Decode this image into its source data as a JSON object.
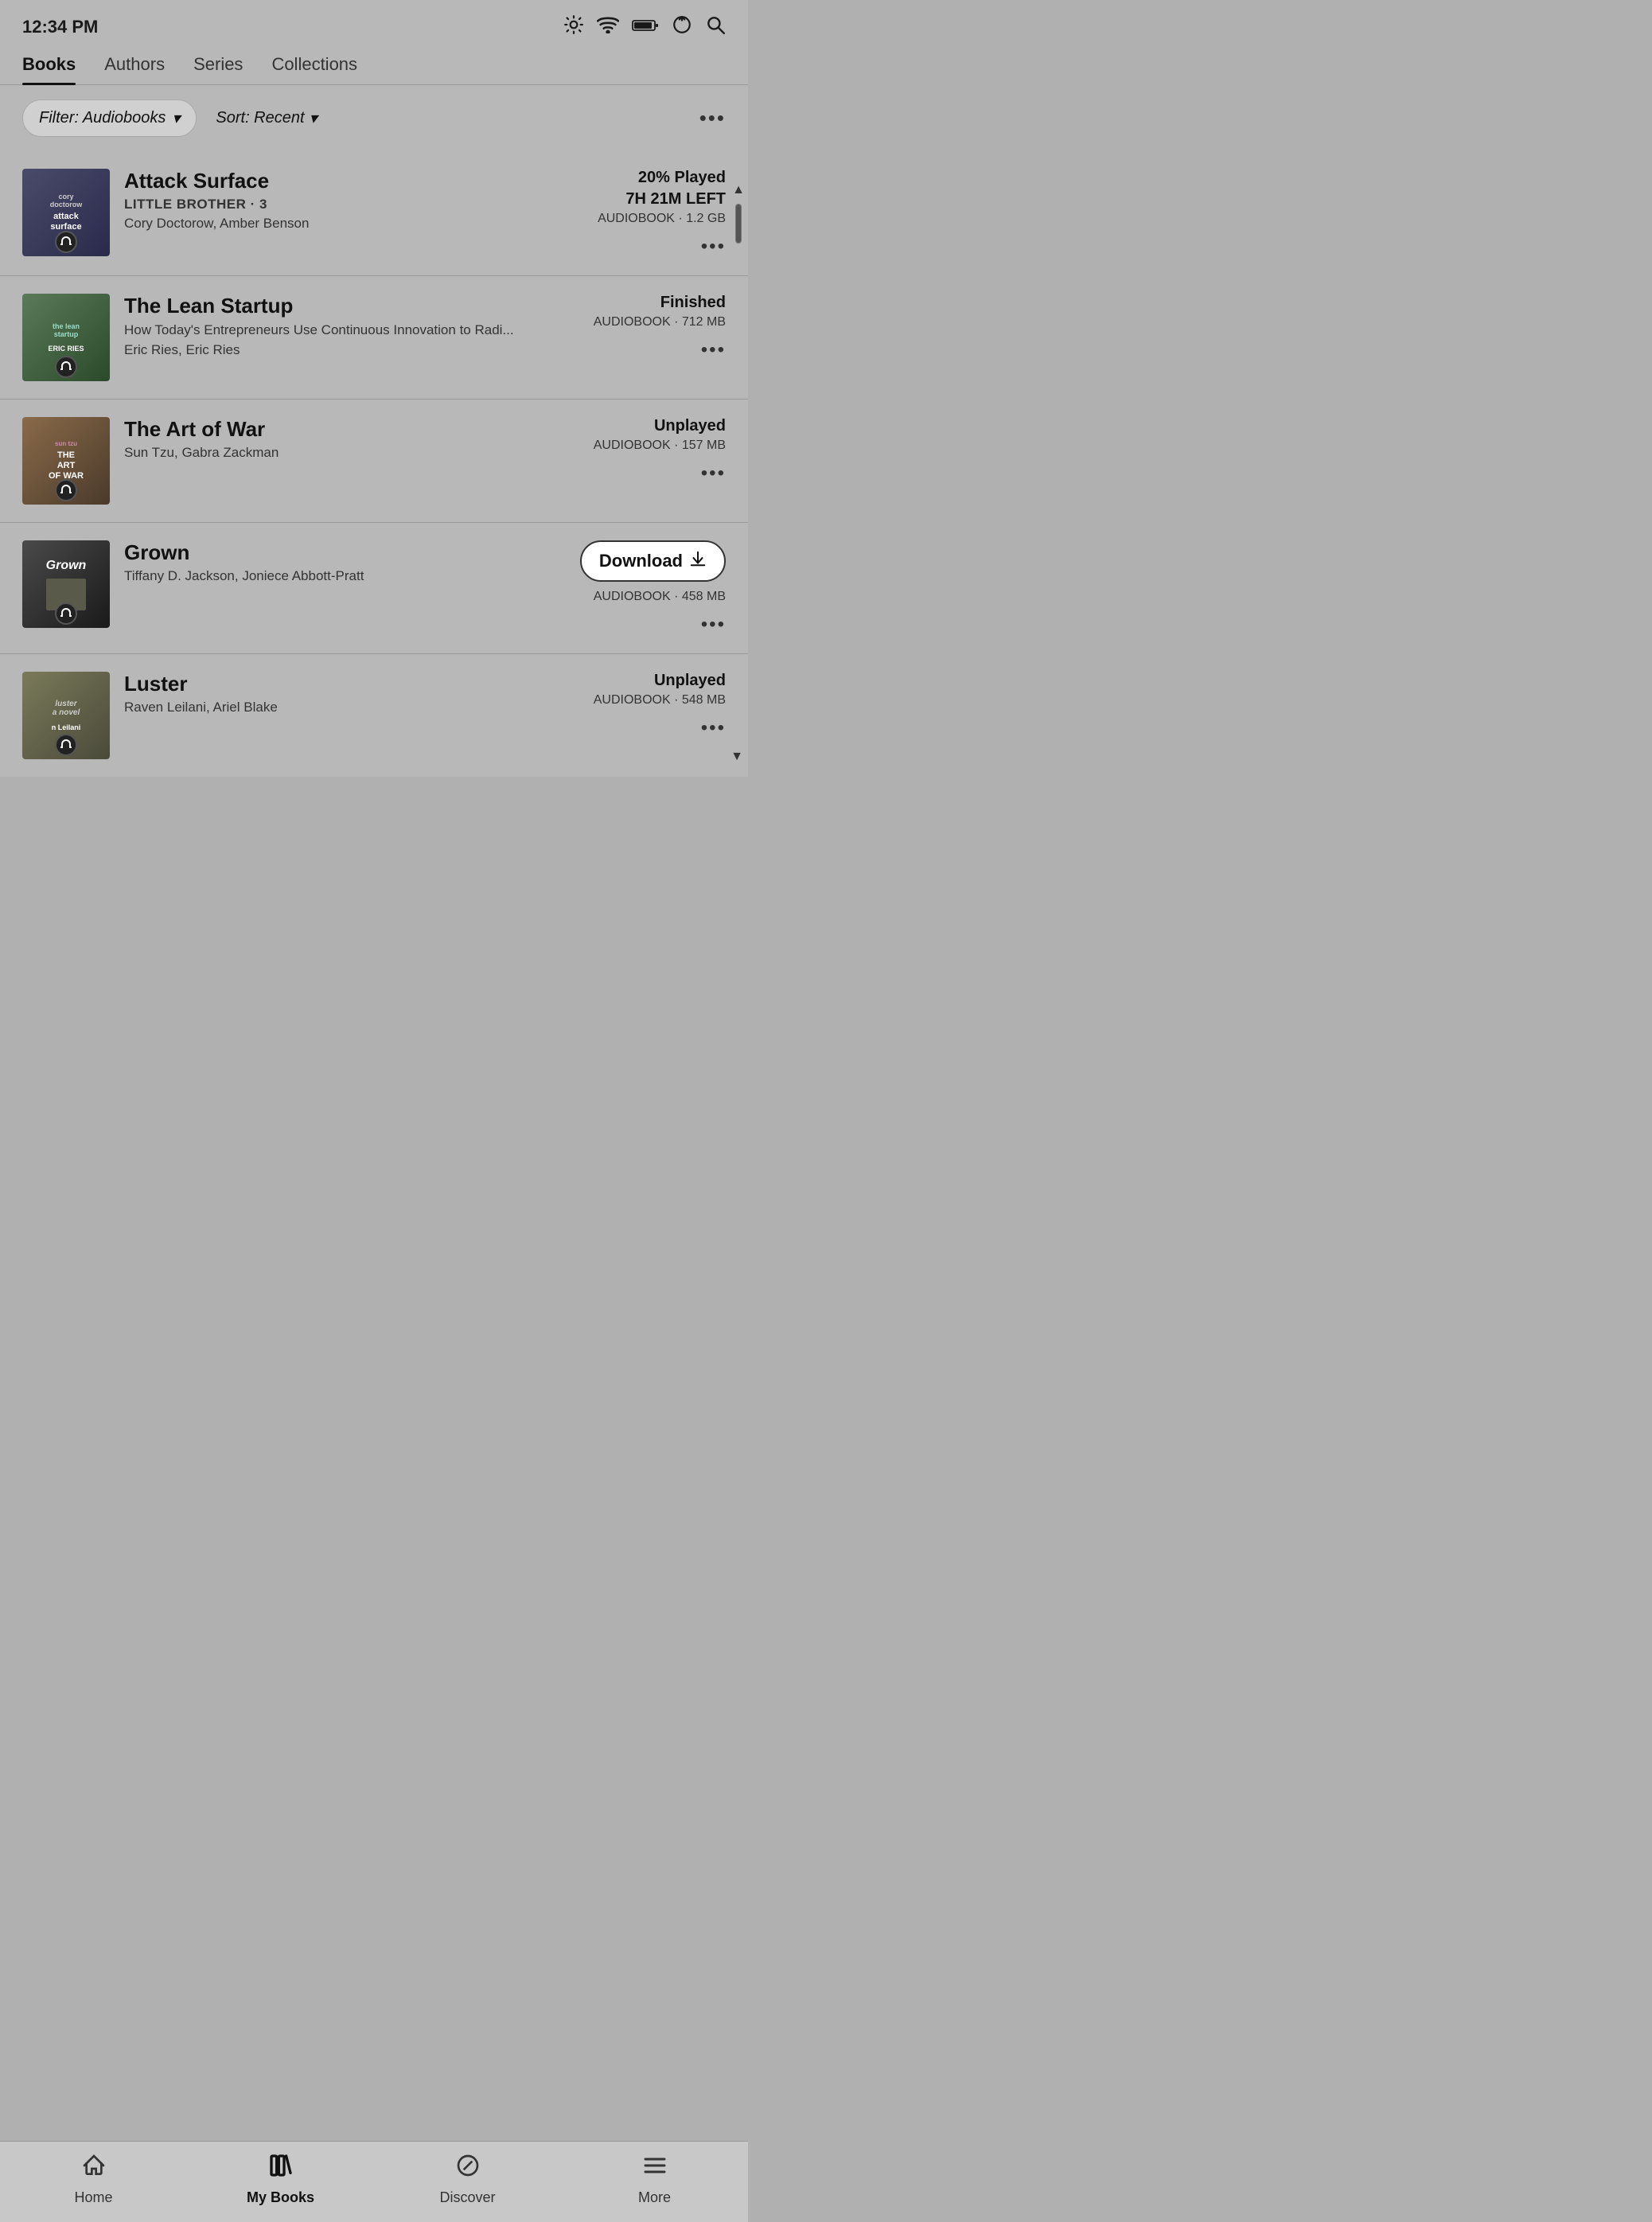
{
  "statusBar": {
    "time": "12:34 PM"
  },
  "tabs": [
    {
      "id": "books",
      "label": "Books",
      "active": true
    },
    {
      "id": "authors",
      "label": "Authors",
      "active": false
    },
    {
      "id": "series",
      "label": "Series",
      "active": false
    },
    {
      "id": "collections",
      "label": "Collections",
      "active": false
    }
  ],
  "filterBar": {
    "filterLabel": "Filter: Audiobooks",
    "sortLabel": "Sort: Recent",
    "filterChevron": "▾",
    "sortChevron": "▾",
    "moreDots": "•••"
  },
  "books": [
    {
      "id": "attack-surface",
      "title": "Attack Surface",
      "series": "LITTLE BROTHER · 3",
      "subtitle": null,
      "authors": "Cory Doctorow, Amber Benson",
      "status": "20% Played",
      "timeLeft": "7H 21M LEFT",
      "format": "AUDIOBOOK · 1.2 GB",
      "showDownload": false,
      "coverStyle": "attack",
      "coverAuthor": "cory\ndoctorow",
      "coverTitle": "attack\nsurface"
    },
    {
      "id": "lean-startup",
      "title": "The Lean Startup",
      "series": null,
      "subtitle": "How Today's Entrepreneurs Use Continuous Innovation to Radi...",
      "authors": "Eric Ries, Eric Ries",
      "status": "Finished",
      "timeLeft": null,
      "format": "AUDIOBOOK · 712 MB",
      "showDownload": false,
      "coverStyle": "lean",
      "coverAuthor": "THE LEAN\nSTARTUP",
      "coverTitle": "ERIC RIES"
    },
    {
      "id": "art-of-war",
      "title": "The Art of War",
      "series": null,
      "subtitle": null,
      "authors": "Sun Tzu, Gabra Zackman",
      "status": "Unplayed",
      "timeLeft": null,
      "format": "AUDIOBOOK · 157 MB",
      "showDownload": false,
      "coverStyle": "art",
      "coverAuthor": "SUN TZU",
      "coverTitle": "THE\nART\nOF WAR"
    },
    {
      "id": "grown",
      "title": "Grown",
      "series": null,
      "subtitle": null,
      "authors": "Tiffany D. Jackson, Joniece Abbott-Pratt",
      "status": null,
      "timeLeft": null,
      "format": "AUDIOBOOK · 458 MB",
      "showDownload": true,
      "downloadLabel": "Download",
      "coverStyle": "grown",
      "coverAuthor": "",
      "coverTitle": "Grown"
    },
    {
      "id": "luster",
      "title": "Luster",
      "series": null,
      "subtitle": null,
      "authors": "Raven Leilani, Ariel Blake",
      "status": "Unplayed",
      "timeLeft": null,
      "format": "AUDIOBOOK · 548 MB",
      "showDownload": false,
      "coverStyle": "luster",
      "coverAuthor": "Luster\na novel",
      "coverTitle": "n Leilani"
    }
  ],
  "bottomNav": [
    {
      "id": "home",
      "label": "Home",
      "active": false
    },
    {
      "id": "mybooks",
      "label": "My Books",
      "active": true
    },
    {
      "id": "discover",
      "label": "Discover",
      "active": false
    },
    {
      "id": "more",
      "label": "More",
      "active": false
    }
  ]
}
